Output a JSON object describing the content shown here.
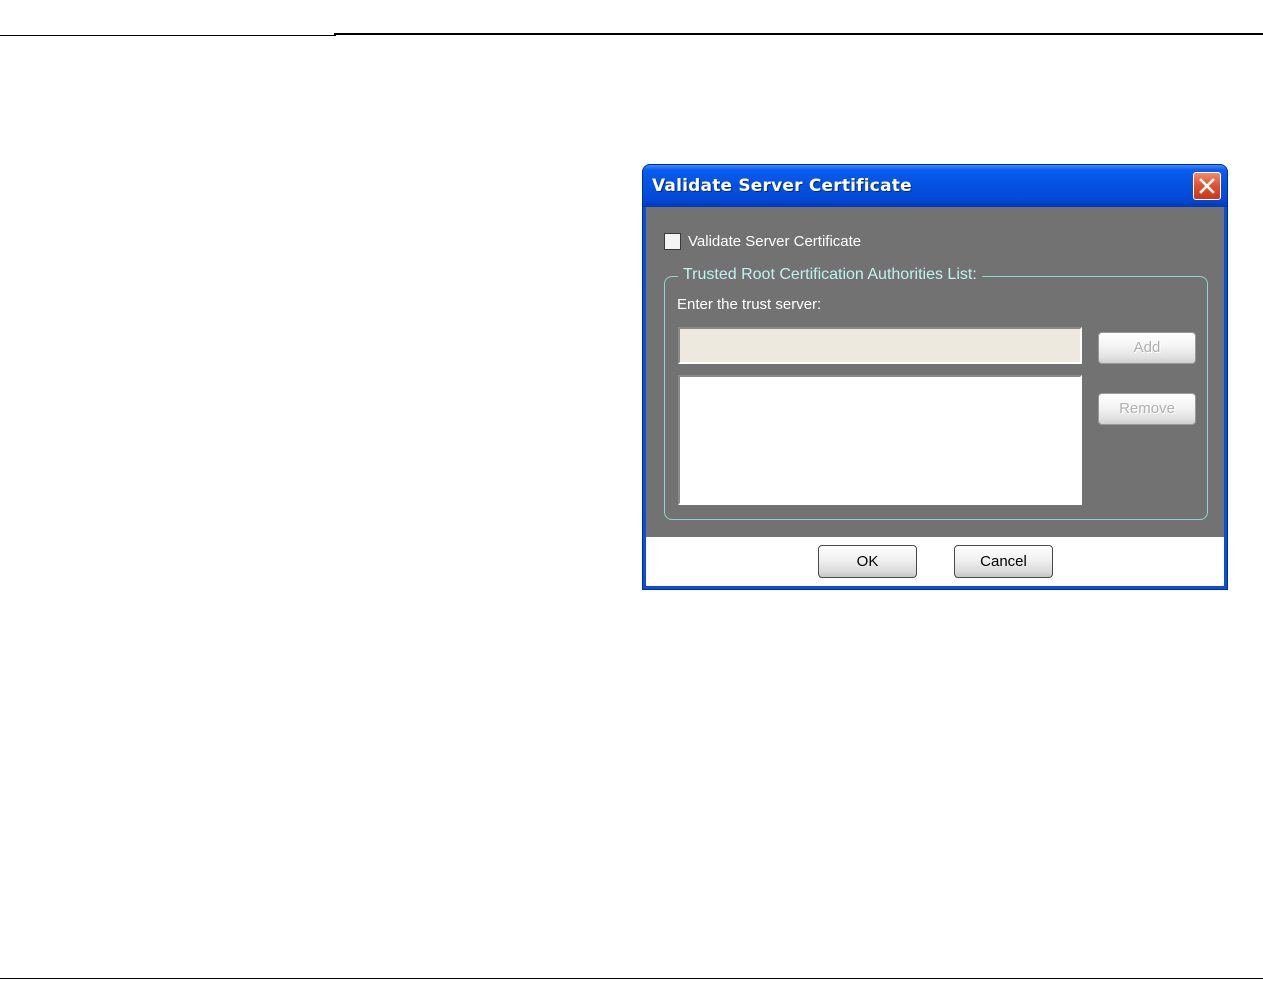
{
  "dialog": {
    "title": "Validate Server Certificate",
    "close_icon": "close-icon",
    "validate_checkbox": {
      "label": "Validate Server Certificate",
      "checked": false
    },
    "group": {
      "legend": "Trusted Root Certification Authorities List:",
      "trust_label": "Enter the trust server:",
      "trust_input_value": "",
      "trust_list_items": [],
      "add_label": "Add",
      "remove_label": "Remove"
    },
    "footer": {
      "ok_label": "OK",
      "cancel_label": "Cancel"
    }
  },
  "colors": {
    "titlebar": "#0352e0",
    "close_button": "#e0502d",
    "body": "#727272",
    "group_border": "#8fd6cf",
    "legend_text": "#bff3ee",
    "input_background": "#eee9df"
  }
}
